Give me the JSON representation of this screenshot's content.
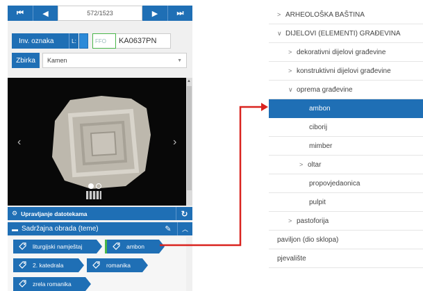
{
  "nav": {
    "first_label": "⏮",
    "prev_label": "◀",
    "counter": "572/1523",
    "next_label": "▶",
    "last_label": "⏭"
  },
  "inventory": {
    "label": "Inv. oznaka",
    "l_label": "L:",
    "ffo_placeholder": "FFO",
    "code_value": "KA0637PN"
  },
  "zbirka": {
    "label": "Zbirka",
    "value": "Kamen"
  },
  "file_manager": {
    "label": "Upravljanje datotekama"
  },
  "content_panel": {
    "label": "Sadržajna obrada (teme)"
  },
  "tags": [
    {
      "label": "liturgijski namještaj"
    },
    {
      "label": "ambon"
    },
    {
      "label": "2. katedrala"
    },
    {
      "label": "romanika"
    },
    {
      "label": "zrela romanika"
    }
  ],
  "tree": [
    {
      "label": "ARHEOLOŠKA BAŠTINA",
      "chevron": ">"
    },
    {
      "label": "DIJELOVI (ELEMENTI) GRAĐEVINA",
      "chevron": "∨"
    },
    {
      "label": "dekorativni dijelovi građevine",
      "chevron": ">"
    },
    {
      "label": "konstruktivni dijelovi građevine",
      "chevron": ">"
    },
    {
      "label": "oprema građevine",
      "chevron": "∨"
    },
    {
      "label": "ambon",
      "chevron": ""
    },
    {
      "label": "ciborij",
      "chevron": ""
    },
    {
      "label": "mimber",
      "chevron": ""
    },
    {
      "label": "oltar",
      "chevron": ">"
    },
    {
      "label": "propovjedaonica",
      "chevron": ""
    },
    {
      "label": "pulpit",
      "chevron": ""
    },
    {
      "label": "pastoforija",
      "chevron": ">"
    },
    {
      "label": "paviljon (dio sklopa)",
      "chevron": ""
    },
    {
      "label": "pjevalište",
      "chevron": ""
    }
  ],
  "colors": {
    "accent": "#1f6fb5",
    "connector": "#d9231f",
    "highlight": "#49b649"
  }
}
